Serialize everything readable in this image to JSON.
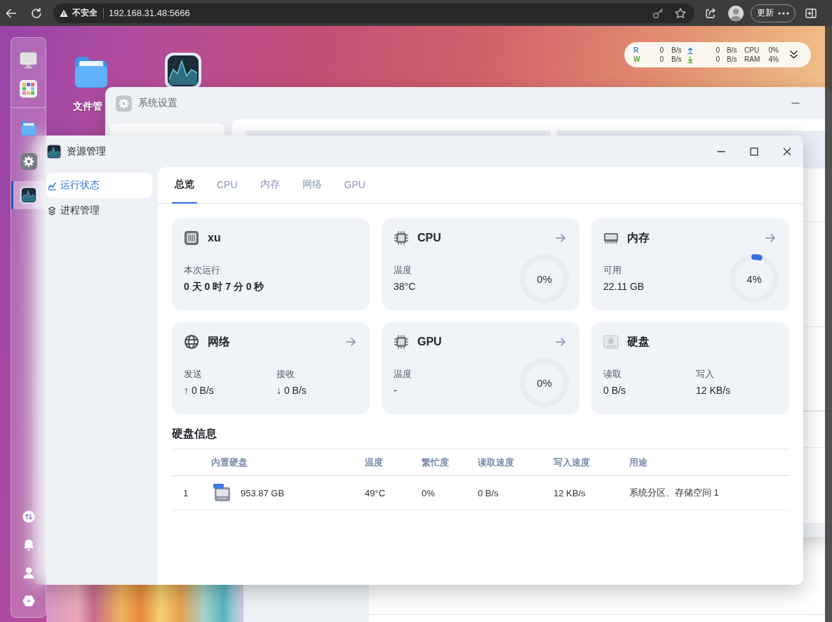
{
  "browser": {
    "security_label": "不安全",
    "url": "192.168.31.48:5666",
    "update_button": "更新"
  },
  "desktop_icons": [
    {
      "kind": "folder",
      "label": "文件管"
    },
    {
      "kind": "activity"
    }
  ],
  "stats_widget": {
    "rows": [
      {
        "label": "R",
        "color": "#3f78d8",
        "kind": "up",
        "value_1": "0",
        "unit_1": "B/s",
        "value_2": "0",
        "unit_2": "B/s",
        "metric": "CPU",
        "metric_value": "0%"
      },
      {
        "label": "W",
        "color": "#5aa63c",
        "kind": "down",
        "value_1": "0",
        "unit_1": "B/s",
        "value_2": "0",
        "unit_2": "B/s",
        "metric": "RAM",
        "metric_value": "4%"
      }
    ]
  },
  "settings_window": {
    "title": "系统设置"
  },
  "resource_window": {
    "title": "资源管理",
    "sidebar": [
      {
        "kind": "chart",
        "label": "运行状态",
        "selected": true
      },
      {
        "kind": "layers",
        "label": "进程管理",
        "selected": false
      }
    ],
    "tabs": [
      {
        "label": "总览",
        "selected": true
      },
      {
        "label": "CPU",
        "selected": false
      },
      {
        "label": "内存",
        "selected": false
      },
      {
        "label": "网络",
        "selected": false
      },
      {
        "label": "GPU",
        "selected": false
      }
    ],
    "cards": [
      {
        "kind": "host",
        "title": "xu",
        "link": false,
        "fields": [
          {
            "label": "本次运行",
            "value": "0 天 0 时 7 分 0 秒"
          }
        ]
      },
      {
        "kind": "cpu",
        "title": "CPU",
        "link": true,
        "fields": [
          {
            "label": "温度",
            "value": "38°C"
          }
        ],
        "ring": {
          "level": 0,
          "reading": "0%"
        }
      },
      {
        "kind": "memory",
        "title": "内存",
        "link": true,
        "fields": [
          {
            "label": "可用",
            "value": "22.11 GB"
          }
        ],
        "ring": {
          "level": 0.04,
          "reading": "4%"
        }
      },
      {
        "kind": "network",
        "title": "网络",
        "link": true,
        "fields": [
          {
            "label": "发送",
            "value": "↑ 0 B/s"
          },
          {
            "label": "接收",
            "value": "↓ 0 B/s"
          }
        ]
      },
      {
        "kind": "gpu",
        "title": "GPU",
        "link": true,
        "fields": [
          {
            "label": "温度",
            "value": "-"
          }
        ],
        "ring": {
          "level": 0,
          "reading": "0%"
        }
      },
      {
        "kind": "disk",
        "title": "硬盘",
        "link": false,
        "fields": [
          {
            "label": "读取",
            "value": "0 B/s"
          },
          {
            "label": "写入",
            "value": "12 KB/s"
          }
        ]
      }
    ],
    "disk_info": {
      "title": "硬盘信息",
      "columns": [
        "内置硬盘",
        "温度",
        "繁忙度",
        "读取速度",
        "写入速度",
        "用途"
      ],
      "rows": [
        {
          "number": "1",
          "cells": [
            "953.87 GB",
            "49°C",
            "0%",
            "0 B/s",
            "12 KB/s",
            "系统分区、存储空间 1"
          ]
        }
      ]
    }
  },
  "dock": {
    "apps": [
      {
        "kind": "folder",
        "selected": false
      },
      {
        "kind": "settings",
        "selected": false
      },
      {
        "kind": "activity",
        "selected": true
      }
    ]
  }
}
